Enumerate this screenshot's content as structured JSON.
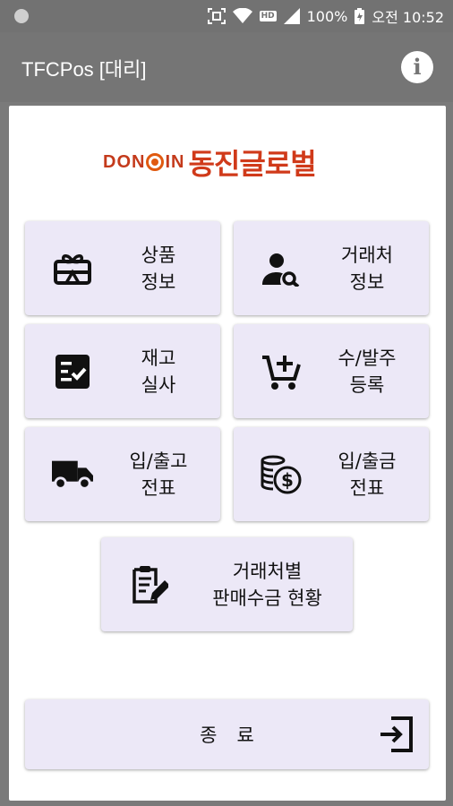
{
  "status_bar": {
    "battery": "100%",
    "time": "오전 10:52",
    "hd": "HD",
    "icons": [
      "notification-dot-icon",
      "scan-icon",
      "wifi-icon",
      "hd-icon",
      "signal-icon",
      "battery-icon"
    ]
  },
  "app_bar": {
    "title": "TFCPos [대리]",
    "info_icon": "i"
  },
  "logo": {
    "en_left": "DON",
    "en_right": "IN",
    "ko": "동진글로벌"
  },
  "menu": [
    {
      "line1": "상품",
      "line2": "정보",
      "icon": "gift-card-icon"
    },
    {
      "line1": "거래처",
      "line2": "정보",
      "icon": "user-search-icon"
    },
    {
      "line1": "재고",
      "line2": "실사",
      "icon": "checklist-icon"
    },
    {
      "line1": "수/발주",
      "line2": "등록",
      "icon": "cart-add-icon"
    },
    {
      "line1": "입/출고",
      "line2": "전표",
      "icon": "truck-icon"
    },
    {
      "line1": "입/출금",
      "line2": "전표",
      "icon": "coins-icon"
    },
    {
      "line1": "거래처별",
      "line2": "판매수금 현황",
      "icon": "clipboard-edit-icon"
    }
  ],
  "exit": {
    "label": "종료",
    "icon": "exit-icon"
  },
  "colors": {
    "accent_button": "#ece8f7",
    "app_bar": "#757575",
    "logo_red": "#d03a1a"
  }
}
